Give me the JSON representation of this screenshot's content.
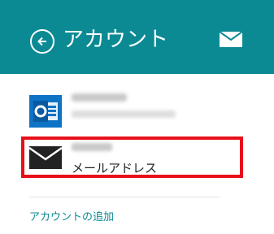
{
  "header": {
    "title": "アカウント",
    "back_icon": "back-arrow-icon",
    "mail_icon": "mail-icon",
    "background": "#0b8a94"
  },
  "accounts": [
    {
      "type": "outlook",
      "icon": "outlook-icon",
      "name": "",
      "email": ""
    },
    {
      "type": "mail",
      "icon": "mail-icon",
      "name": "",
      "label": "メールアドレス",
      "highlighted": true
    }
  ],
  "add_account_label": "アカウントの追加",
  "colors": {
    "accent": "#0b8a94",
    "highlight_border": "#e8101b",
    "outlook_blue": "#0e72c5"
  }
}
